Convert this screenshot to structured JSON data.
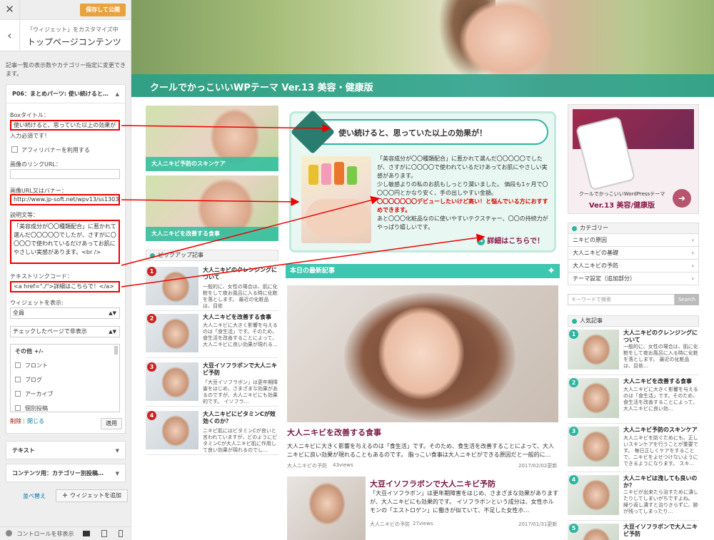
{
  "customizer": {
    "close_icon": "close-icon",
    "publish_label": "保存して公開",
    "back_icon": "chevron-left-icon",
    "breadcrumb": "「ウィジェット」をカスタマイズ中",
    "title": "トップページコンテンツ",
    "description": "記事一覧の表示数やカテゴリー指定に変更できます。",
    "widget_header": "P06：まとめパーツ: 使い続けると…",
    "box_title_label": "Boxタイトル：",
    "box_title_value": "使い続けると、思っていた以上の効果が",
    "required_note": "入力必須です！",
    "affiliate_label": "アフィリバナーを利用する",
    "image_link_label": "画像のリンクURL：",
    "image_url_label": "画像URL又はバナー：",
    "image_url_value": "http://www.jp-soft.net/wpv13/ss1303",
    "desc_label": "説明文等：",
    "desc_value": "「美容成分が〇〇種類配合」に惹かれて選んだ〇〇〇〇〇でしたが、さすがに〇〇〇〇で使われているだけあってお肌にやさしい実感があります。<br />",
    "textlink_label": "テキストリンクコード：",
    "textlink_value": "<a href=\"./\">詳細はこちらで！</a>",
    "widget_show_label": "ウィジェットを表示:",
    "widget_show_value": "全員",
    "page_filter_value": "チェックしたページで非表示",
    "list_header": "その他 +/-",
    "list_items": [
      "フロント",
      "ブログ",
      "アーカイブ",
      "個別投稿"
    ],
    "delete_label": "削除",
    "close_label": "閉じる",
    "apply_label": "適用",
    "text_widget": "テキスト",
    "contents_widget": "コンテンツ用：カテゴリー別投稿…",
    "reorder_label": "並べ替え",
    "add_widget_label": "ウィジェットを追加",
    "hide_controls_label": "コントロールを非表示"
  },
  "site": {
    "header_title": "クールでかっこいいWPテーマ Ver.13 美容・健康版",
    "left_thumbs": [
      "大人ニキビ予防のスキンケア",
      "大人ニキビを改善する食事"
    ],
    "pickup_title": "ピックアップ記事",
    "pickup_items": [
      {
        "num": "1",
        "title": "大人ニキビのクレンジングについて",
        "text": "一般的に、女性の場合は、肌に化粧をして夜お風呂に入る時に化粧を落とします。 最近の化粧品は、目依"
      },
      {
        "num": "2",
        "title": "大人ニキビを改善する食事",
        "text": "大人ニキビに大きく影響を与えるのは「食生活」です。そのため、食生活を改善することによって、大人ニキビに良い効果が現れる…"
      },
      {
        "num": "3",
        "title": "大豆イソフラボンで大人ニキビ予防",
        "text": "「大豆イソフラボン」は更年期障害をはじめ、さまざまな効果があるのですが、大人ニキビにも効果的です。 イソフラ…"
      },
      {
        "num": "4",
        "title": "大人ニキビにビタミンCが效効くのか？",
        "text": "ニキビ肌にはビタミンCが良いと言われていますが、どのようにビタミンCが大人ニキビ肌に作用して良い効果が現れるのでし…"
      }
    ],
    "matome_title": "使い続けると、思っていた以上の効果が！",
    "matome_text1": "「美容成分が〇〇種類配合」に惹かれて選んだ〇〇〇〇〇でしたが、さすがに〇〇〇〇で使われているだけあってお肌にやさしい実感があります。",
    "matome_text2": "少し敏感よりの私のお肌もしっとり潤いました。 価段も1ヶ月で〇〇〇〇円とかなり安く、手の出しやすい金額。",
    "matome_text3": "〇〇〇〇〇〇〇デビューしたいけど高い！と悩んでいる方におすすめできます。",
    "matome_text4": "あと〇〇〇化粧品なのに使いやすいテクスチャー、〇〇の持続力がやっぱり嬉しいです。",
    "matome_more": "詳細はこちらで！",
    "latest_title": "本日の最新記事",
    "article1": {
      "title": "大人ニキビを改善する食事",
      "text": "大人ニキビに大きく影響を与えるのは「食生活」です。そのため、食生活を改善することによって、大人ニキビに良い効果が現れることもあるのです。 脂っこい食事は大人ニキビができる原因だと一般的に…",
      "cat": "大人ニキビの予防",
      "views": "43views",
      "date": "2017/02/02更新"
    },
    "article2": {
      "title": "大豆イソフラボンで大人ニキビ予防",
      "text": "「大豆イソフラボン」は更年期障害をはじめ、さまざまな効果がありますが、大人ニキビにも効果的です。 イソフラボンという成分は、女性ホルモンの「エストロゲン」に働きが似ていて、不足した女性ホ…",
      "cat": "大人ニキビの予防",
      "views": "27views",
      "date": "2017/01/31更新"
    },
    "banner_text1": "クールでかっこいいWordPressテーマ",
    "banner_text2": "Ver.13 美容/健康版",
    "category_title": "カテゴリー",
    "categories": [
      "ニキビの原因",
      "大人ニキビの基礎",
      "大人ニキビの予防",
      "テーマ設定（追加部分）"
    ],
    "search_placeholder": "キーワードで検索",
    "search_button": "Search",
    "popular_title": "人気記事",
    "popular_items": [
      {
        "num": "1",
        "title": "大人ニキビのクレンジングについて",
        "text": "一般的に、女性の場合は、肌に化粧をして夜お風呂に入る時に化粧を落とします。 最近の化粧品は、目依…"
      },
      {
        "num": "2",
        "title": "大人ニキビを改善する食事",
        "text": "大人ニキビに大きく影響を与えるのは「食生活」です。そのため、食生活を改善することによって、大人ニキビに良い効…"
      },
      {
        "num": "3",
        "title": "大人ニキビ予防のスキンケア",
        "text": "大人ニキビを防ぐためにも、正しいスキンケアを行うことが重要です。 毎日正しくケアをすることで、ニキビをよせつけないようにできるようになります。 スキ…"
      },
      {
        "num": "4",
        "title": "大人ニキビは洩しても良いのか？",
        "text": "ニキビが出来たら治すために潰したりしてしまいがちですよね。 繰り返し潰すと治りきらずに、跡が残ってしまったり…"
      },
      {
        "num": "5",
        "title": "大豆イソフラボンで大人ニキビ予防",
        "text": ""
      }
    ]
  }
}
